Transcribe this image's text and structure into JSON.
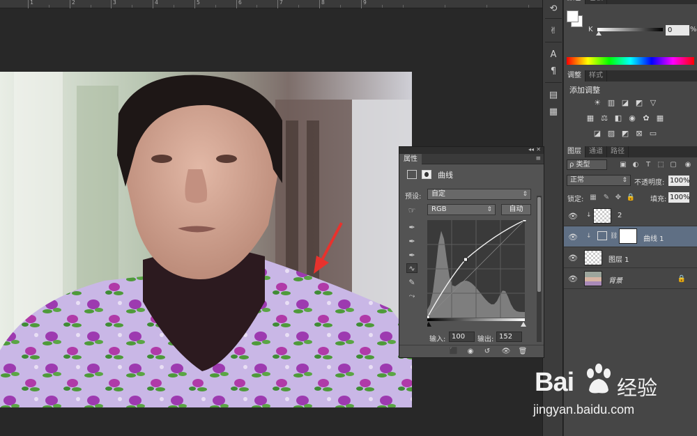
{
  "ruler": {
    "labels": [
      "1",
      "2",
      "3",
      "4",
      "5",
      "6",
      "7",
      "8",
      "9"
    ]
  },
  "properties": {
    "tab_label": "属性",
    "collapse_glyph": "◂◂",
    "close_glyph": "✕",
    "menu_glyph": "≡",
    "adjustment_title": "曲线",
    "preset_label": "预设:",
    "preset_value": "自定",
    "channel_value": "RGB",
    "auto_label": "自动",
    "input_label": "输入:",
    "input_value": "100",
    "output_label": "输出:",
    "output_value": "152",
    "curve_point": {
      "input": 100,
      "output": 152
    }
  },
  "color_panel": {
    "tabs": [
      "颜色",
      "色板"
    ],
    "k_label": "K",
    "k_value": "0",
    "k_unit": "%"
  },
  "adjustments_panel": {
    "tabs": [
      "调整",
      "样式"
    ],
    "title": "添加调整"
  },
  "layers_panel": {
    "tabs": [
      "图层",
      "通道",
      "路径"
    ],
    "filter_label": "ρ 类型",
    "blend_mode": "正常",
    "opacity_label": "不透明度:",
    "opacity_value": "100%",
    "lock_label": "锁定:",
    "fill_label": "填充:",
    "fill_value": "100%",
    "layers": [
      {
        "name": "2"
      },
      {
        "name": "曲线 1"
      },
      {
        "name": "图层 1"
      },
      {
        "name": "背景"
      }
    ]
  },
  "watermark": {
    "brand": "Bai",
    "brand_cn": "经验",
    "url": "jingyan.baidu.com"
  },
  "colors": {
    "panel_bg": "#464646",
    "selected_layer": "#5f6f84",
    "arrow": "#e8322d"
  }
}
